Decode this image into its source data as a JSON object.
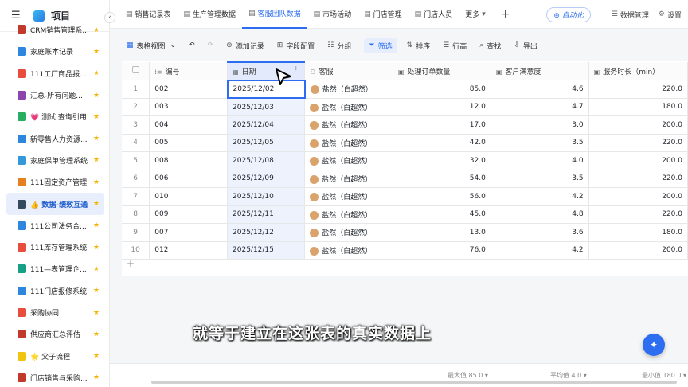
{
  "app": {
    "title": "项目"
  },
  "sidebar": {
    "items": [
      {
        "label": "CRM销售管理系...",
        "color": "#c0392b",
        "active": false
      },
      {
        "label": "家庭账本记录",
        "color": "#2e86de",
        "active": false
      },
      {
        "label": "111工厂商品报...",
        "color": "#e74c3c",
        "active": false
      },
      {
        "label": "汇总-所有问题...",
        "color": "#8e44ad",
        "active": false
      },
      {
        "label": "💗 测试 查询引用",
        "color": "#27ae60",
        "active": false
      },
      {
        "label": "新零售人力资源...",
        "color": "#2e86de",
        "active": false
      },
      {
        "label": "家庭保单管理系统",
        "color": "#3498db",
        "active": false
      },
      {
        "label": "111固定资产管理",
        "color": "#e67e22",
        "active": false
      },
      {
        "label": "👍 数据-绩效互通",
        "color": "#34495e",
        "active": true
      },
      {
        "label": "111公司法务合...",
        "color": "#2e86de",
        "active": false
      },
      {
        "label": "111库存管理系统",
        "color": "#e74c3c",
        "active": false
      },
      {
        "label": "111—表管理企...",
        "color": "#16a085",
        "active": false
      },
      {
        "label": "111门店报修系统",
        "color": "#2e86de",
        "active": false
      },
      {
        "label": "采购协同",
        "color": "#e74c3c",
        "active": false
      },
      {
        "label": "供应商汇总评估",
        "color": "#c0392b",
        "active": false
      },
      {
        "label": "🌟 父子流程",
        "color": "#f1c40f",
        "active": false
      },
      {
        "label": "门店销售与采购...",
        "color": "#c0392b",
        "active": false
      }
    ]
  },
  "tabs": [
    {
      "label": "销售记录表",
      "icon": "table-icon",
      "active": false
    },
    {
      "label": "生产管理数据",
      "icon": "table-icon",
      "active": false
    },
    {
      "label": "客服团队数据",
      "icon": "table-icon",
      "active": true
    },
    {
      "label": "市场活动",
      "icon": "table-icon",
      "active": false
    },
    {
      "label": "门店管理",
      "icon": "table-icon",
      "active": false
    },
    {
      "label": "门店人员",
      "icon": "table-icon",
      "active": false
    },
    {
      "label": "更多",
      "icon": "chevron-down-icon",
      "active": false
    }
  ],
  "topright": {
    "auto": "自动化",
    "data_manage": "数据管理",
    "settings": "设置"
  },
  "toolbar": {
    "view": "表格视图",
    "add": "添加记录",
    "fields": "字段配置",
    "group": "分组",
    "filter": "筛选",
    "sort": "排序",
    "row_height": "行高",
    "search": "查找",
    "export": "导出"
  },
  "table": {
    "headers": {
      "id": "编号",
      "date": "日期",
      "agent": "客服",
      "orders": "处理订单数量",
      "satisfaction": "客户满意度",
      "duration": "服务时长（min）"
    },
    "rows": [
      {
        "n": "1",
        "id": "002",
        "date": "2025/12/02",
        "agent": "盐然（白超然）",
        "orders": "85.0",
        "sat": "4.6",
        "dur": "220.0"
      },
      {
        "n": "2",
        "id": "003",
        "date": "2025/12/03",
        "agent": "盐然（白超然）",
        "orders": "12.0",
        "sat": "4.7",
        "dur": "180.0"
      },
      {
        "n": "3",
        "id": "004",
        "date": "2025/12/04",
        "agent": "盐然（白超然）",
        "orders": "17.0",
        "sat": "3.0",
        "dur": "200.0"
      },
      {
        "n": "4",
        "id": "005",
        "date": "2025/12/05",
        "agent": "盐然（白超然）",
        "orders": "42.0",
        "sat": "3.5",
        "dur": "220.0"
      },
      {
        "n": "5",
        "id": "008",
        "date": "2025/12/08",
        "agent": "盐然（白超然）",
        "orders": "32.0",
        "sat": "4.0",
        "dur": "200.0"
      },
      {
        "n": "6",
        "id": "006",
        "date": "2025/12/09",
        "agent": "盐然（白超然）",
        "orders": "54.0",
        "sat": "3.5",
        "dur": "220.0"
      },
      {
        "n": "7",
        "id": "010",
        "date": "2025/12/10",
        "agent": "盐然（白超然）",
        "orders": "56.0",
        "sat": "4.2",
        "dur": "200.0"
      },
      {
        "n": "8",
        "id": "009",
        "date": "2025/12/11",
        "agent": "盐然（白超然）",
        "orders": "45.0",
        "sat": "4.8",
        "dur": "220.0"
      },
      {
        "n": "9",
        "id": "007",
        "date": "2025/12/12",
        "agent": "盐然（白超然）",
        "orders": "13.0",
        "sat": "3.6",
        "dur": "180.0"
      },
      {
        "n": "10",
        "id": "012",
        "date": "2025/12/15",
        "agent": "盐然（白超然）",
        "orders": "76.0",
        "sat": "4.2",
        "dur": "200.0"
      }
    ]
  },
  "footer": {
    "max": "最大值 85.0",
    "avg": "平均值 4.0",
    "min": "最小值 180.0"
  },
  "subtitle": "就等于建立在这张表的真实数据上",
  "colors": {
    "accent": "#2d6ef0",
    "star": "#f4b400"
  }
}
